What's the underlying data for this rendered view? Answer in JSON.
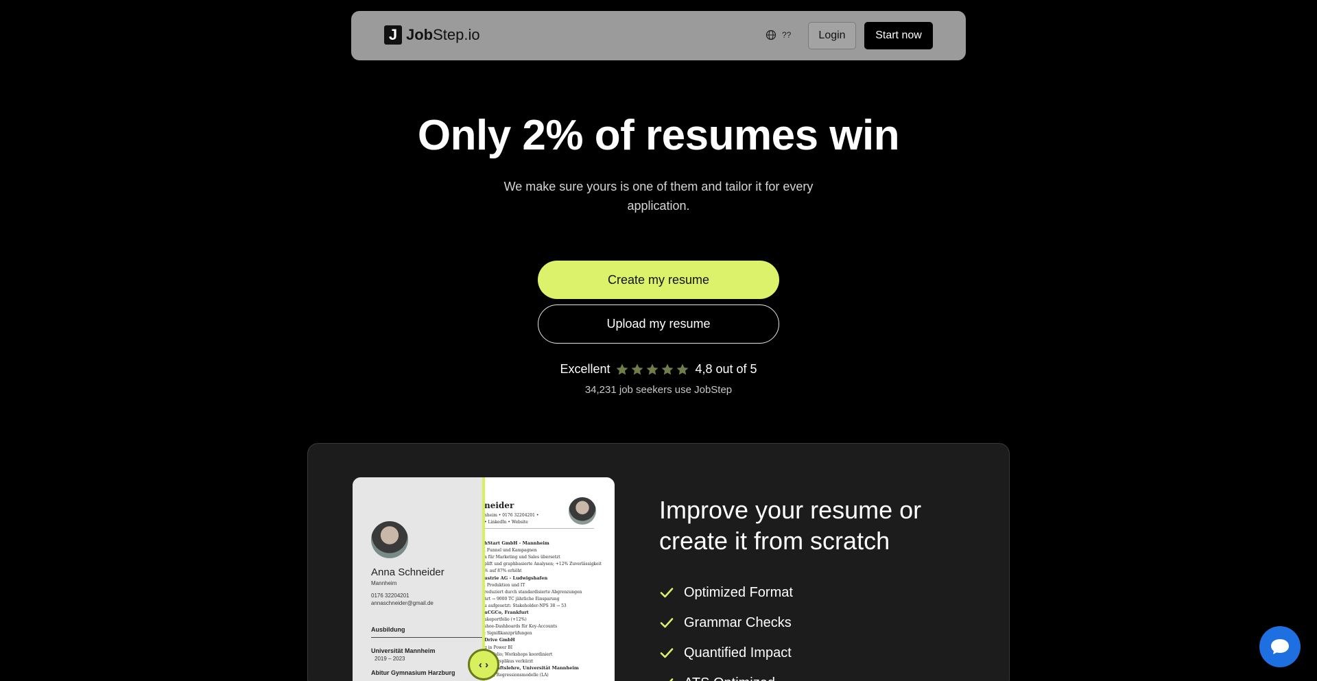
{
  "nav": {
    "logo_mark": "J",
    "logo_bold": "Job",
    "logo_rest": "Step.io",
    "lang_label": "??",
    "login_label": "Login",
    "start_label": "Start now"
  },
  "hero": {
    "title": "Only 2% of resumes win",
    "subtitle": "We make sure yours is one of them and tailor it for every application.",
    "create_label": "Create my resume",
    "upload_label": "Upload my resume",
    "rating_word": "Excellent",
    "rating_value": 4.8,
    "rating_max": 5,
    "rating_text": "4,8 out of 5",
    "seekers": "34,231 job seekers use JobStep"
  },
  "resume_preview": {
    "name": "Anna Schneider",
    "city": "Mannheim",
    "phone": "0176 32204201",
    "email": "annaschneider@gmail.de",
    "section": "Ausbildung",
    "university": "Universität Mannheim",
    "uni_years": "2019 – 2023",
    "school": "Abitur Gymnasium Harzburg",
    "right_name": "neider",
    "right_contact_1": "nheim  •  0176 32204201  •",
    "right_contact_2": "•  LinkedIn  •  Website",
    "right_lines": [
      "hStart GmbH - Mannheim",
      ", Funnel und Kampagnen",
      "n für Marketing und Sales übersetzt",
      "plift und graphbasierte Analysen; +12% Zuverlässigkeit",
      "% auf 87% erhöht",
      "ustrie AG - Ludwigshafen",
      ", Produktion und IT",
      "reduziert durch standardisierte Abgrenzungen",
      "hrt → 9000 TC jährliche Einsparung",
      "u aufgesetzt: Stakeholder-NPS 38 → 53",
      "nCGCo, Frankfurt",
      "akeportfolio (+12%)",
      "shoe-Dashboards für Key-Accounts",
      "; Signifikanzprüfungen",
      "Drive GmbH",
      "g in Power BI",
      "Portfolio; Workshops koordiniert",
      "gertingsplikus verkürzt",
      "rtschaftslehre, Universität Mannheim",
      "tung, Regressionsmodelle (LA)"
    ],
    "handle_label": "‹ ›"
  },
  "feature": {
    "title": "Improve your resume or create it from scratch",
    "items": [
      "Optimized Format",
      "Grammar Checks",
      "Quantified Impact",
      "ATS Optimized"
    ]
  },
  "colors": {
    "accent": "#dcf26a",
    "nav_bg": "#9b9b9b",
    "card_bg": "#1c1c1c",
    "chat": "#1e6fe0"
  },
  "icons": {
    "globe": "globe-icon",
    "star": "star-icon",
    "check": "check-icon",
    "chat": "chat-bubble-icon"
  }
}
